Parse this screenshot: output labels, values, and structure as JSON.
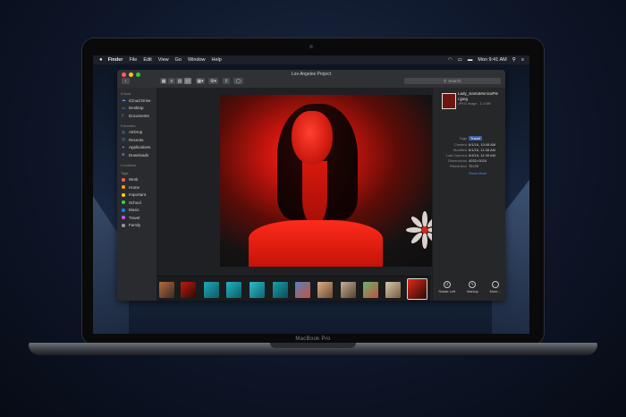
{
  "device": {
    "label": "MacBook Pro"
  },
  "menubar": {
    "apple": "",
    "app_name": "Finder",
    "items": [
      "File",
      "Edit",
      "View",
      "Go",
      "Window",
      "Help"
    ],
    "clock": "Mon 9:41 AM"
  },
  "window": {
    "title": "Los Angeles Project",
    "search_placeholder": "Search",
    "traffic_lights": {
      "close": "#fe5f57",
      "minimize": "#febc2e",
      "zoom": "#28c840"
    }
  },
  "sidebar": {
    "icloud_header": "iCloud",
    "icloud_items": [
      "iCloud Drive",
      "Desktop",
      "Documents"
    ],
    "favorites_header": "Favorites",
    "favorites_items": [
      "AirDrop",
      "Recents",
      "Applications",
      "Downloads"
    ],
    "locations_header": "Locations",
    "tags_header": "Tags",
    "tags": [
      {
        "label": "Work",
        "color": "#fe5f57"
      },
      {
        "label": "Home",
        "color": "#fe9f0a"
      },
      {
        "label": "Important",
        "color": "#ffd60a"
      },
      {
        "label": "School",
        "color": "#32d74b"
      },
      {
        "label": "Music",
        "color": "#0a84ff"
      },
      {
        "label": "Travel",
        "color": "#bf5af2"
      },
      {
        "label": "Family",
        "color": "#98989d"
      }
    ]
  },
  "inspector": {
    "file_name": "Lady_SantaMonicaPie r.jpeg",
    "file_type": "JPEG image - 1.4 MB",
    "rows": [
      {
        "key": "Tags",
        "value": "Travel"
      },
      {
        "key": "Created",
        "value": "6/1/16, 10:08 AM"
      },
      {
        "key": "Modified",
        "value": "6/1/16, 11:38 AM"
      },
      {
        "key": "Last Opened",
        "value": "6/4/16, 11:39 AM"
      },
      {
        "key": "Dimensions",
        "value": "4032×3024"
      },
      {
        "key": "Resolution",
        "value": "72×72"
      }
    ],
    "show_more": "Show More",
    "actions": [
      {
        "label": "Rotate Left",
        "icon": "rotate-left-icon"
      },
      {
        "label": "Markup",
        "icon": "markup-icon"
      },
      {
        "label": "More...",
        "icon": "more-icon"
      }
    ]
  },
  "colors": {
    "accent": "#0a84ff",
    "tag_pill": "#3b5ea8"
  }
}
